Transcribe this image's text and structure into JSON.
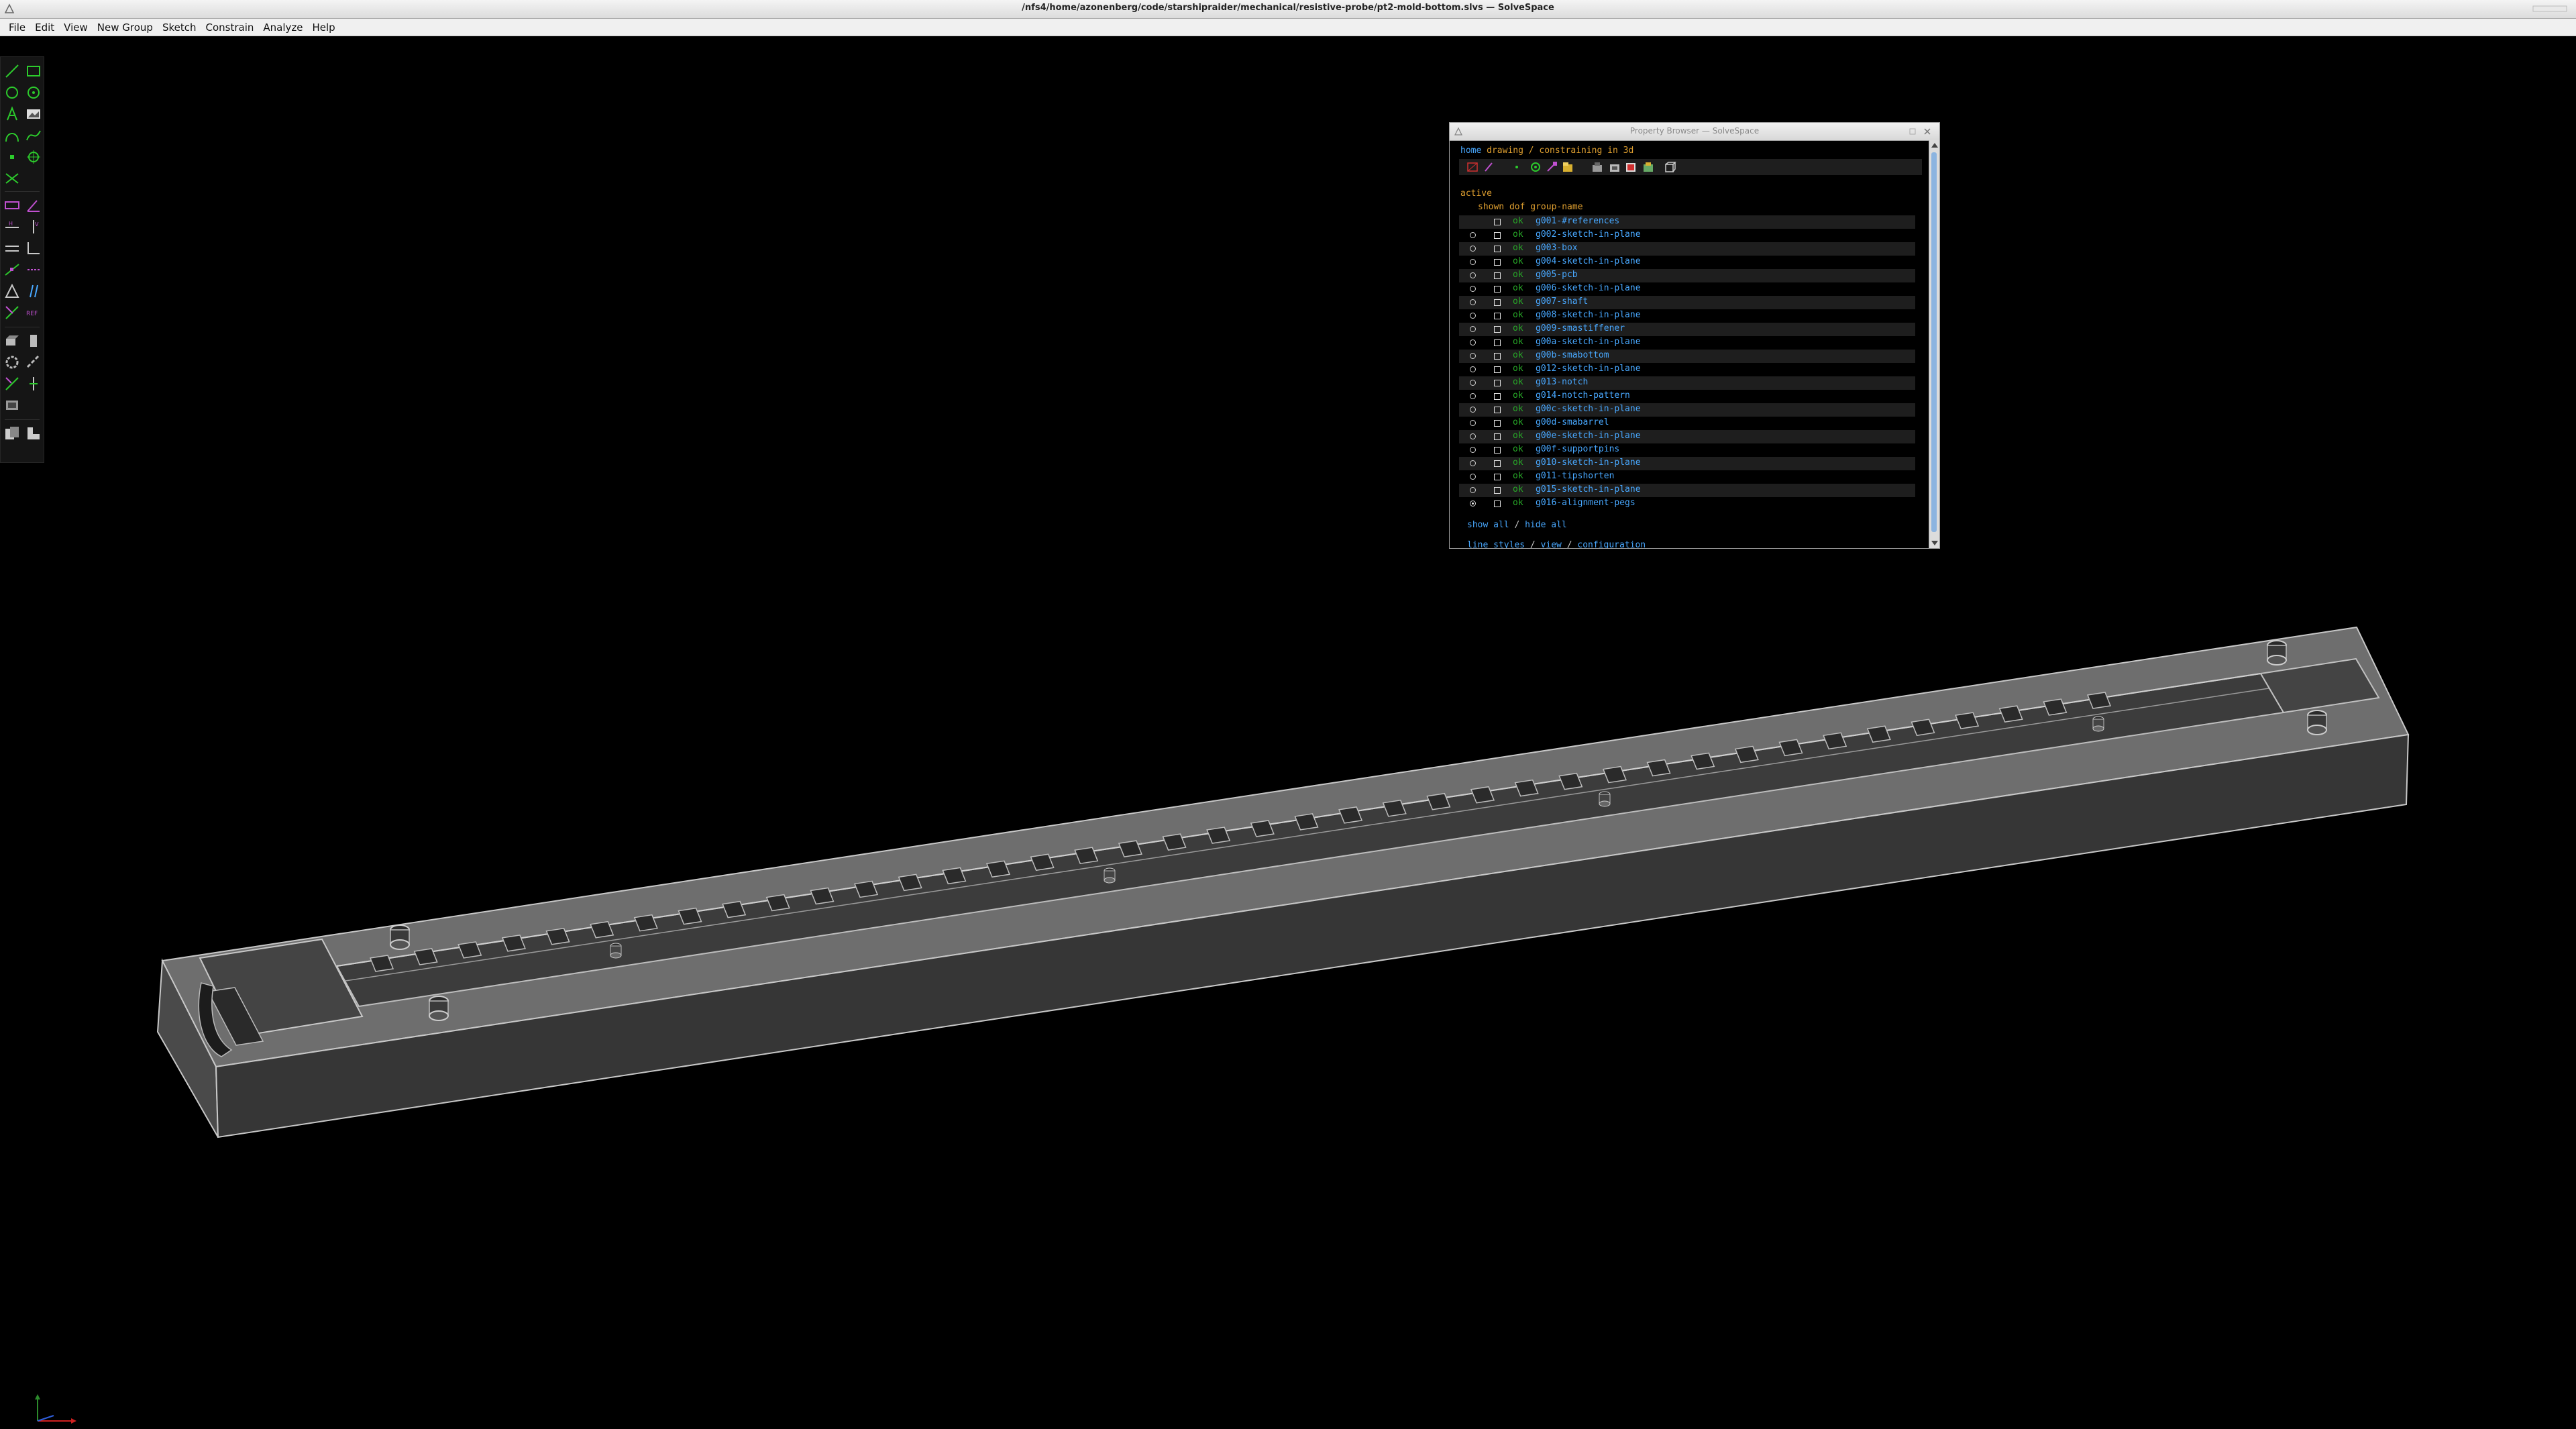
{
  "window": {
    "title": "/nfs4/home/azonenberg/code/starshipraider/mechanical/resistive-probe/pt2-mold-bottom.slvs — SolveSpace"
  },
  "menubar": {
    "items": [
      "File",
      "Edit",
      "View",
      "New Group",
      "Sketch",
      "Constrain",
      "Analyze",
      "Help"
    ]
  },
  "toolbar": {
    "tools": [
      "line-segment-icon",
      "rectangle-icon",
      "circle-icon",
      "arc-icon",
      "text-icon",
      "image-icon",
      "tangent-arc-icon",
      "cubic-spline-icon",
      "datum-point-icon",
      "workplane-icon",
      "split-curves-icon",
      "distance-dimension-icon",
      "angle-dimension-icon",
      "horizontal-constraint-icon",
      "vertical-constraint-icon",
      "parallel-constraint-icon",
      "nearest-orthogonal-icon",
      "point-on-entity-icon",
      "symmetric-constraint-icon",
      "equal-length-icon",
      "midpoint-icon",
      "same-orientation-icon",
      "reference-icon",
      "extrude-icon",
      "lathe-icon",
      "step-rotating-icon",
      "step-translating-icon",
      "anchor-icon",
      "vertical-anchor-icon",
      "sketch-in-3d-icon",
      "export-icon",
      "workplane-sketch-icon"
    ]
  },
  "property_browser": {
    "title": "Property Browser — SolveSpace",
    "nav": {
      "home": "home",
      "drawing": "drawing / constraining in 3d"
    },
    "icons": [
      "show-workplanes-icon",
      "show-normals-icon",
      "show-points-icon",
      "show-construction-icon",
      "show-constraints-icon",
      "show-faces-icon",
      "show-outlines-icon",
      "show-edges-icon",
      "show-mesh-icon",
      "show-outline-edges-icon",
      "show-hidden-lines-icon"
    ],
    "section": "active",
    "header": "shown dof group-name",
    "groups": [
      {
        "dof": "ok",
        "name": "g001-#references",
        "active": false,
        "radio": false
      },
      {
        "dof": "ok",
        "name": "g002-sketch-in-plane",
        "active": false,
        "radio": true
      },
      {
        "dof": "ok",
        "name": "g003-box",
        "active": false,
        "radio": true
      },
      {
        "dof": "ok",
        "name": "g004-sketch-in-plane",
        "active": false,
        "radio": true
      },
      {
        "dof": "ok",
        "name": "g005-pcb",
        "active": false,
        "radio": true
      },
      {
        "dof": "ok",
        "name": "g006-sketch-in-plane",
        "active": false,
        "radio": true
      },
      {
        "dof": "ok",
        "name": "g007-shaft",
        "active": false,
        "radio": true
      },
      {
        "dof": "ok",
        "name": "g008-sketch-in-plane",
        "active": false,
        "radio": true
      },
      {
        "dof": "ok",
        "name": "g009-smastiffener",
        "active": false,
        "radio": true
      },
      {
        "dof": "ok",
        "name": "g00a-sketch-in-plane",
        "active": false,
        "radio": true
      },
      {
        "dof": "ok",
        "name": "g00b-smabottom",
        "active": false,
        "radio": true
      },
      {
        "dof": "ok",
        "name": "g012-sketch-in-plane",
        "active": false,
        "radio": true
      },
      {
        "dof": "ok",
        "name": "g013-notch",
        "active": false,
        "radio": true
      },
      {
        "dof": "ok",
        "name": "g014-notch-pattern",
        "active": false,
        "radio": true
      },
      {
        "dof": "ok",
        "name": "g00c-sketch-in-plane",
        "active": false,
        "radio": true
      },
      {
        "dof": "ok",
        "name": "g00d-smabarrel",
        "active": false,
        "radio": true
      },
      {
        "dof": "ok",
        "name": "g00e-sketch-in-plane",
        "active": false,
        "radio": true
      },
      {
        "dof": "ok",
        "name": "g00f-supportpins",
        "active": false,
        "radio": true
      },
      {
        "dof": "ok",
        "name": "g010-sketch-in-plane",
        "active": false,
        "radio": true
      },
      {
        "dof": "ok",
        "name": "g011-tipshorten",
        "active": false,
        "radio": true
      },
      {
        "dof": "ok",
        "name": "g015-sketch-in-plane",
        "active": false,
        "radio": true
      },
      {
        "dof": "ok",
        "name": "g016-alignment-pegs",
        "active": true,
        "radio": true
      }
    ],
    "footer": {
      "show_all": "show all",
      "sep": " / ",
      "hide_all": "hide all",
      "line_styles": "line styles",
      "view": "view",
      "configuration": "configuration"
    }
  },
  "colors": {
    "background": "#000000",
    "model_top": "#8a8a8a",
    "model_front": "#3a3a3a",
    "model_edge": "#c8c8c8",
    "link": "#48a8ff",
    "ok": "#28a828",
    "header": "#e0a030"
  }
}
